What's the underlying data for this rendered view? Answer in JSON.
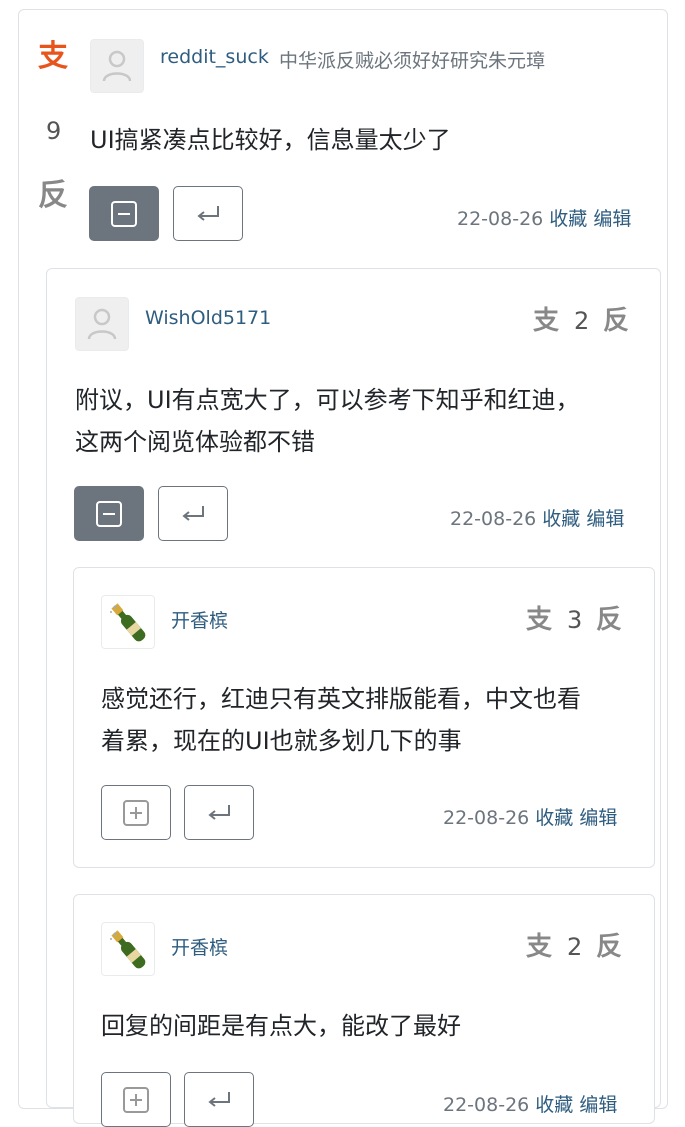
{
  "comments": [
    {
      "user": "reddit_suck",
      "bio": "中华派反贼必须好好研究朱元璋",
      "score": "9",
      "text": "UI搞紧凑点比较好，信息量太少了",
      "date": "22-08-26",
      "collect": "收藏",
      "edit": "编辑"
    },
    {
      "user": "WishOld5171",
      "score": "2",
      "text_line1": "附议，UI有点宽大了，可以参考下知乎和红迪，",
      "text_line2": "这两个阅览体验都不错",
      "date": "22-08-26",
      "collect": "收藏",
      "edit": "编辑"
    },
    {
      "user": "开香槟",
      "score": "3",
      "text_line1": "感觉还行，红迪只有英文排版能看，中文也看",
      "text_line2": "着累，现在的UI也就多划几下的事",
      "date": "22-08-26",
      "collect": "收藏",
      "edit": "编辑"
    },
    {
      "user": "开香槟",
      "score": "2",
      "text": "回复的间距是有点大，能改了最好",
      "date": "22-08-26",
      "collect": "收藏",
      "edit": "编辑"
    }
  ],
  "vote_labels": {
    "up": "支",
    "down": "反"
  },
  "icons": {
    "avatar_default": "user-silhouette-icon",
    "avatar_bottle": "champagne-bottle-icon",
    "collapse": "minus-square-icon",
    "expand": "plus-square-icon",
    "reply": "reply-arrow-icon"
  },
  "colors": {
    "link": "#2f5d80",
    "muted": "#6c757d",
    "upvote_active": "#e8551c",
    "button_dark": "#6c757d"
  }
}
